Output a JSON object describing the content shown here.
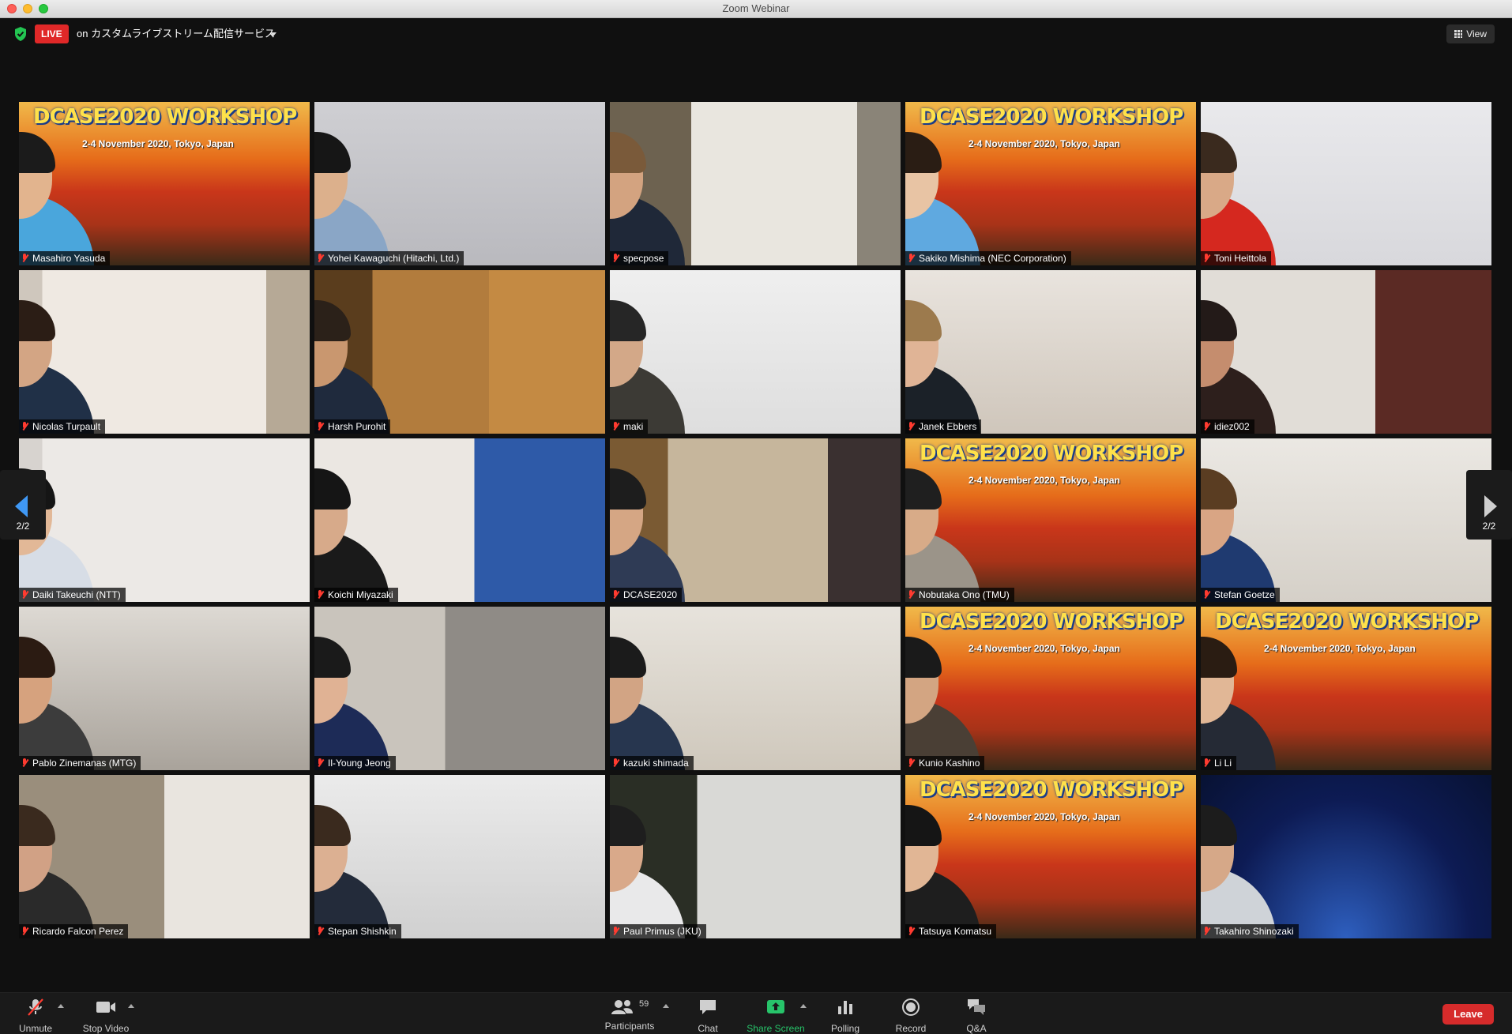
{
  "window": {
    "title": "Zoom Webinar"
  },
  "topbar": {
    "live_badge": "LIVE",
    "stream_label": "on カスタムライブストリーム配信サービス",
    "view_label": "View"
  },
  "pager": {
    "left_label": "2/2",
    "right_label": "2/2"
  },
  "banner": {
    "title": "DCASE2020 WORKSHOP",
    "sub": "2-4 November 2020, Tokyo, Japan"
  },
  "participants": [
    {
      "name": "Masahiro Yasuda"
    },
    {
      "name": "Yohei Kawaguchi (Hitachi, Ltd.)"
    },
    {
      "name": "specpose"
    },
    {
      "name": "Sakiko Mishima (NEC Corporation)"
    },
    {
      "name": "Toni Heittola"
    },
    {
      "name": "Nicolas Turpault"
    },
    {
      "name": "Harsh Purohit"
    },
    {
      "name": "maki"
    },
    {
      "name": "Janek Ebbers"
    },
    {
      "name": "idiez002"
    },
    {
      "name": "Daiki Takeuchi (NTT)"
    },
    {
      "name": "Koichi Miyazaki"
    },
    {
      "name": "DCASE2020"
    },
    {
      "name": "Nobutaka Ono (TMU)"
    },
    {
      "name": "Stefan Goetze"
    },
    {
      "name": "Pablo Zinemanas (MTG)"
    },
    {
      "name": "Il-Young Jeong"
    },
    {
      "name": "kazuki shimada"
    },
    {
      "name": "Kunio Kashino"
    },
    {
      "name": "Li Li"
    },
    {
      "name": "Ricardo Falcon Perez"
    },
    {
      "name": "Stepan Shishkin"
    },
    {
      "name": "Paul Primus (JKU)"
    },
    {
      "name": "Tatsuya Komatsu"
    },
    {
      "name": "Takahiro Shinozaki"
    }
  ],
  "toolbar": {
    "unmute": "Unmute",
    "stop_video": "Stop Video",
    "participants": "Participants",
    "participant_count": "59",
    "chat": "Chat",
    "share_screen": "Share Screen",
    "polling": "Polling",
    "record": "Record",
    "qa": "Q&A",
    "leave": "Leave"
  }
}
